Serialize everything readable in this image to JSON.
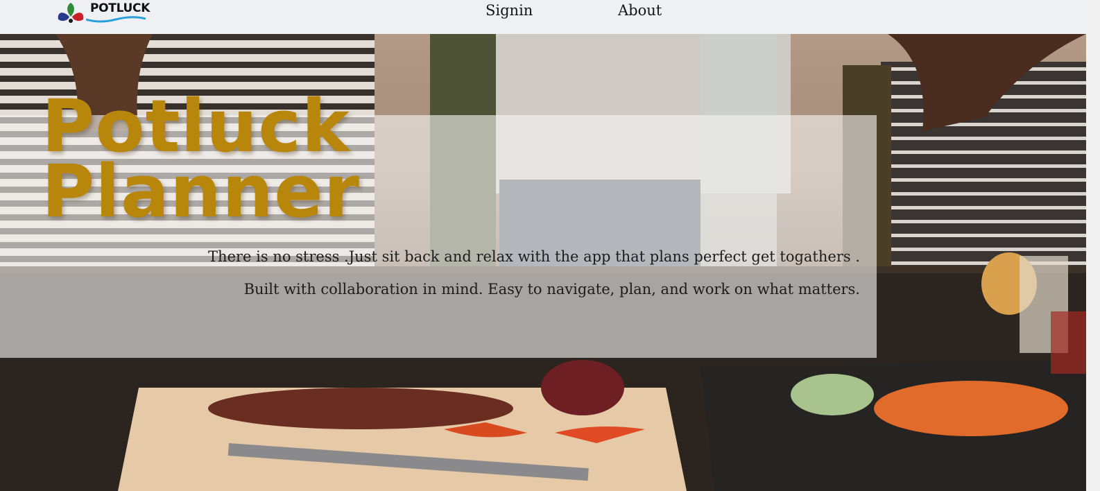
{
  "header": {
    "logo_text": "POTLUCK",
    "nav": [
      {
        "label": "Signin"
      },
      {
        "label": "About"
      }
    ]
  },
  "hero": {
    "title_line1": "Potluck",
    "title_line2": "Planner",
    "tagline1": "There is no stress .Just sit back and relax with the app that plans perfect get togathers .",
    "tagline2": "Built with collaboration in mind. Easy to navigate, plan, and work on what matters."
  },
  "colors": {
    "title": "#b8860b",
    "header_bg": "#eff0f3",
    "overlay": "rgba(245,244,242,0.62)"
  }
}
